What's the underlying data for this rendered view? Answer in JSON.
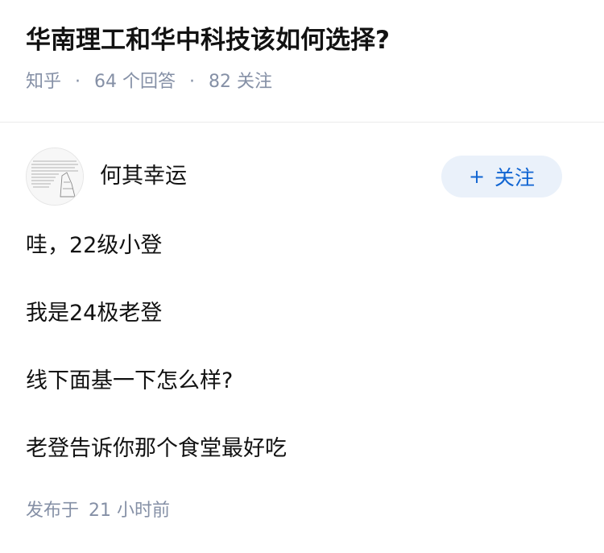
{
  "question": {
    "title": "华南理工和华中科技该如何选择?",
    "source": "知乎",
    "answer_count": "64",
    "answer_label": "个回答",
    "follower_count": "82",
    "follower_label": "关注"
  },
  "answer": {
    "author_name": "何其幸运",
    "follow_button": {
      "icon": "+",
      "label": "关注"
    },
    "lines": [
      "哇，22级小登",
      "我是24极老登",
      "线下面基一下怎么样?",
      "老登告诉你那个食堂最好吃"
    ],
    "publish_label": "发布于",
    "publish_time": "21 小时前"
  },
  "colors": {
    "text_primary": "#121212",
    "text_secondary": "#8590a6",
    "accent": "#0f64d2",
    "follow_bg": "#eaf1fa"
  }
}
